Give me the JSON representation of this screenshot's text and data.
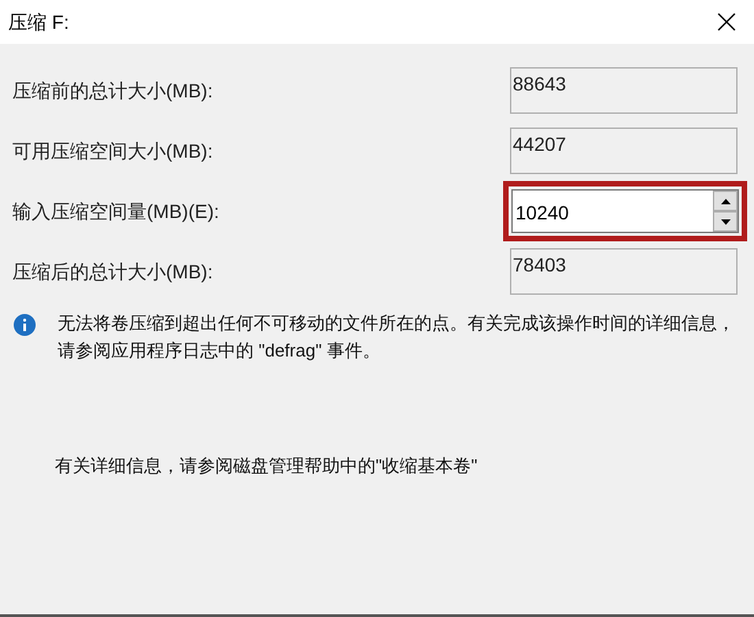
{
  "window": {
    "title": "压缩 F:"
  },
  "fields": [
    {
      "label": "压缩前的总计大小(MB):",
      "value": "88643",
      "kind": "readonly",
      "highlighted": false
    },
    {
      "label": "可用压缩空间大小(MB):",
      "value": "44207",
      "kind": "readonly",
      "highlighted": false
    },
    {
      "label": "输入压缩空间量(MB)(E):",
      "value": "10240",
      "kind": "spin",
      "highlighted": true
    },
    {
      "label": "压缩后的总计大小(MB):",
      "value": "78403",
      "kind": "readonly",
      "highlighted": false
    }
  ],
  "info": "无法将卷压缩到超出任何不可移动的文件所在的点。有关完成该操作时间的详细信息，请参阅应用程序日志中的 \"defrag\" 事件。",
  "help": "有关详细信息，请参阅磁盘管理帮助中的\"收缩基本卷\""
}
